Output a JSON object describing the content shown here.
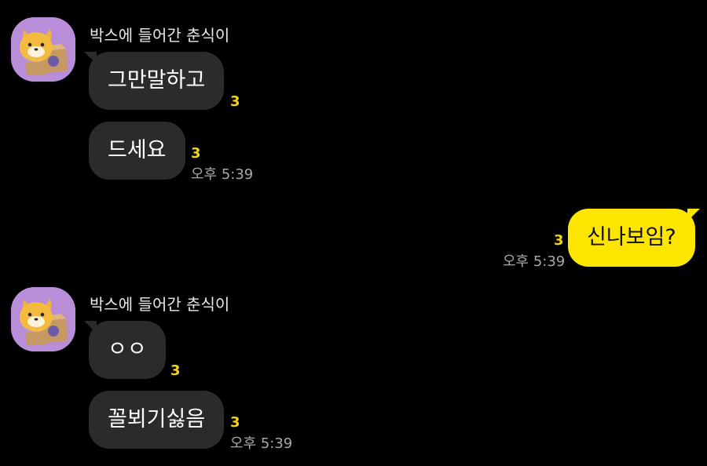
{
  "accent": {
    "mine_bubble": "#fee500",
    "other_bubble": "#2b2b2b",
    "unread": "#f3d21a",
    "background": "#000000"
  },
  "messages": [
    {
      "sender": "박스에 들어간 춘식이",
      "avatar_icon": "cat-in-box-icon",
      "bubbles": [
        {
          "text": "그만말하고",
          "unread": "3"
        },
        {
          "text": "드세요",
          "unread": "3",
          "time": "오후 5:39"
        }
      ]
    },
    {
      "mine": true,
      "bubbles": [
        {
          "text": "신나보임?",
          "unread": "3",
          "time": "오후 5:39"
        }
      ]
    },
    {
      "sender": "박스에 들어간 춘식이",
      "avatar_icon": "cat-in-box-icon",
      "bubbles": [
        {
          "text": "ㅇㅇ",
          "unread": "3"
        },
        {
          "text": "꼴뵈기싫음",
          "unread": "3",
          "time": "오후 5:39"
        }
      ]
    }
  ]
}
